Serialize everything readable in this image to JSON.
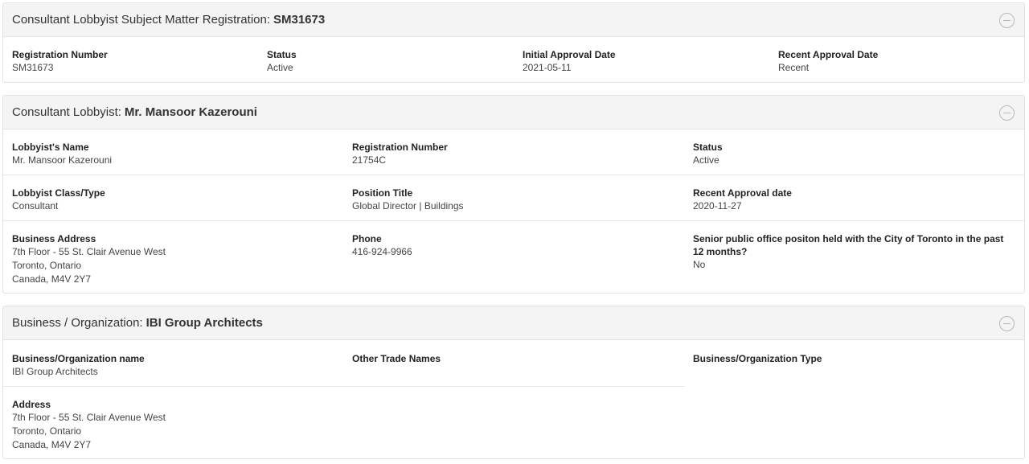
{
  "panel1": {
    "header_prefix": "Consultant Lobbyist Subject Matter Registration:",
    "header_strong": "SM31673",
    "fields": [
      {
        "label": "Registration Number",
        "value": "SM31673"
      },
      {
        "label": "Status",
        "value": "Active"
      },
      {
        "label": "Initial Approval Date",
        "value": "2021-05-11"
      },
      {
        "label": "Recent Approval Date",
        "value": "Recent"
      }
    ]
  },
  "panel2": {
    "header_prefix": "Consultant Lobbyist:",
    "header_strong": "Mr. Mansoor Kazerouni",
    "name": {
      "label": "Lobbyist's Name",
      "value": "Mr. Mansoor Kazerouni"
    },
    "reg_number": {
      "label": "Registration Number",
      "value": "21754C"
    },
    "status": {
      "label": "Status",
      "value": "Active"
    },
    "class_type": {
      "label": "Lobbyist Class/Type",
      "value": "Consultant"
    },
    "position_title": {
      "label": "Position Title",
      "value": "Global Director | Buildings"
    },
    "recent_approval": {
      "label": "Recent Approval date",
      "value": "2020-11-27"
    },
    "business_address": {
      "label": "Business Address",
      "line1": "7th Floor - 55 St. Clair Avenue West",
      "line2": "Toronto, Ontario",
      "line3": "Canada, M4V 2Y7"
    },
    "phone": {
      "label": "Phone",
      "value": "416-924-9966"
    },
    "senior_office": {
      "label": "Senior public office positon held with the City of Toronto in the past 12 months?",
      "value": "No"
    }
  },
  "panel3": {
    "header_prefix": "Business / Organization:",
    "header_strong": "IBI Group Architects",
    "org_name": {
      "label": "Business/Organization name",
      "value": "IBI Group Architects"
    },
    "trade_names": {
      "label": "Other Trade Names",
      "value": ""
    },
    "org_type": {
      "label": "Business/Organization Type",
      "value": ""
    },
    "address": {
      "label": "Address",
      "line1": "7th Floor - 55 St. Clair Avenue West",
      "line2": "Toronto, Ontario",
      "line3": "Canada, M4V 2Y7"
    }
  }
}
